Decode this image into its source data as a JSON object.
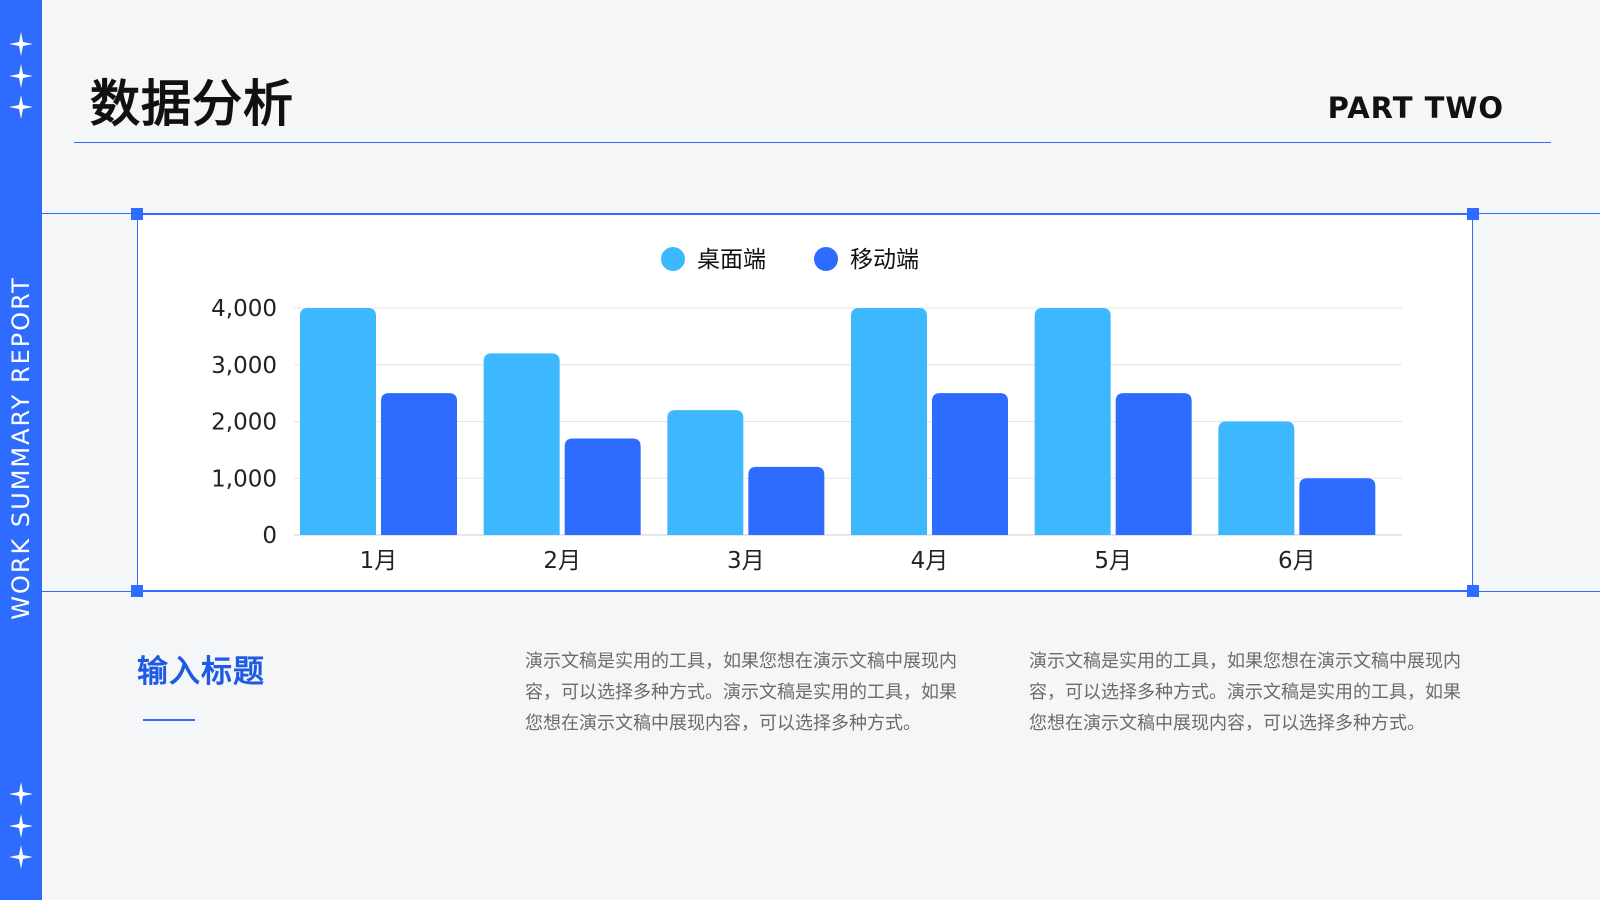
{
  "sidebar": {
    "vertical_text": "WORK SUMMARY REPORT",
    "color": "#2e6bff"
  },
  "header": {
    "title": "数据分析",
    "part_label": "PART TWO"
  },
  "chart_data": {
    "type": "bar",
    "categories": [
      "1月",
      "2月",
      "3月",
      "4月",
      "5月",
      "6月"
    ],
    "series": [
      {
        "name": "桌面端",
        "color": "#3db8ff",
        "values": [
          4000,
          3200,
          2200,
          4000,
          4000,
          2000
        ]
      },
      {
        "name": "移动端",
        "color": "#2e6bff",
        "values": [
          2500,
          1700,
          1200,
          2500,
          2500,
          1000
        ]
      }
    ],
    "ylim": [
      0,
      4000
    ],
    "yticks": [
      0,
      1000,
      2000,
      3000,
      4000
    ],
    "ytick_labels": [
      "0",
      "1,000",
      "2,000",
      "3,000",
      "4,000"
    ],
    "grid": true,
    "legend_position": "top-center"
  },
  "section": {
    "title": "输入标题",
    "paragraphs": [
      "演示文稿是实用的工具，如果您想在演示文稿中展现内容，可以选择多种方式。演示文稿是实用的工具，如果您想在演示文稿中展现内容，可以选择多种方式。",
      "演示文稿是实用的工具，如果您想在演示文稿中展现内容，可以选择多种方式。演示文稿是实用的工具，如果您想在演示文稿中展现内容，可以选择多种方式。"
    ]
  }
}
